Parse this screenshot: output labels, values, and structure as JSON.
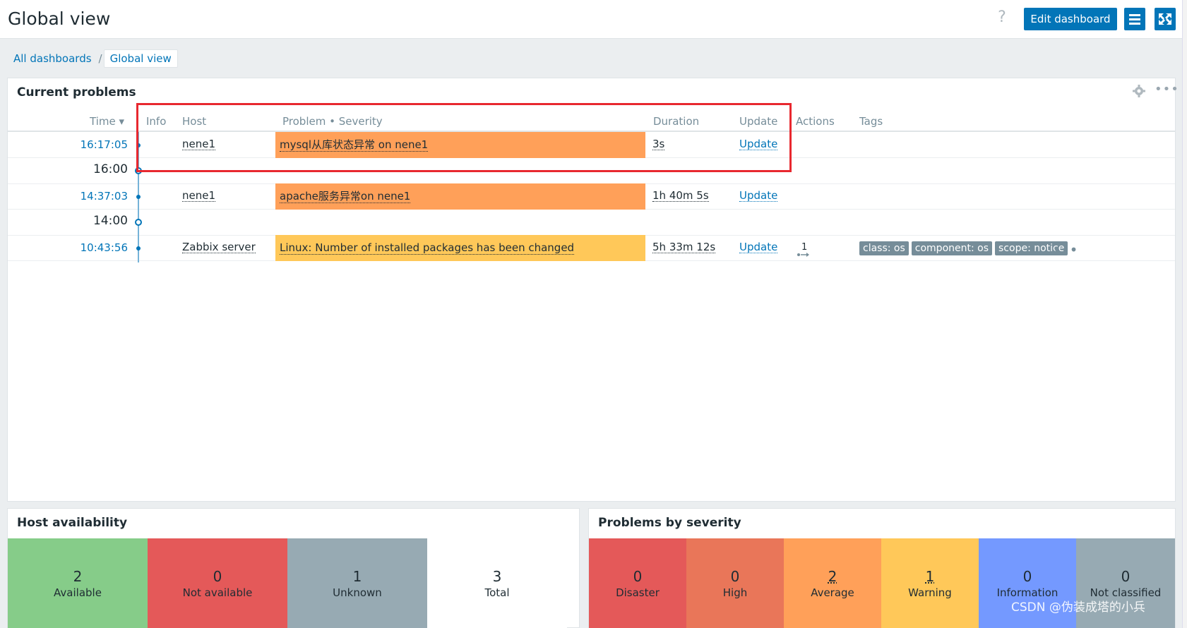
{
  "header": {
    "title": "Global view",
    "help": "?",
    "edit_button": "Edit dashboard"
  },
  "breadcrumb": {
    "all": "All dashboards",
    "sep": "/",
    "current": "Global view"
  },
  "problems_widget": {
    "title": "Current problems",
    "more": "•••",
    "columns": {
      "time": "Time ▾",
      "info": "Info",
      "host": "Host",
      "problem": "Problem • Severity",
      "duration": "Duration",
      "update": "Update",
      "actions": "Actions",
      "tags": "Tags"
    },
    "rows": [
      {
        "time": "16:17:05",
        "host": "nene1",
        "problem": "mysql从库状态异常 on nene1",
        "severity_color": "#ffa059",
        "duration": "3s",
        "update": "Update"
      },
      {
        "time_mark": "16:00"
      },
      {
        "time": "14:37:03",
        "host": "nene1",
        "problem": "apache服务异常on nene1",
        "severity_color": "#ffa059",
        "duration": "1h 40m 5s",
        "update": "Update"
      },
      {
        "time_mark": "14:00"
      },
      {
        "time": "10:43:56",
        "host": "Zabbix server",
        "problem": "Linux: Number of installed packages has been changed",
        "severity_color": "#ffc859",
        "duration": "5h 33m 12s",
        "update": "Update",
        "actions_count": "1",
        "tags": [
          "class: os",
          "component: os",
          "scope: notice"
        ],
        "tags_more": "•••"
      }
    ]
  },
  "host_availability": {
    "title": "Host availability",
    "tiles": [
      {
        "count": "2",
        "label": "Available",
        "color": "#86cc89"
      },
      {
        "count": "0",
        "label": "Not available",
        "color": "#e45959"
      },
      {
        "count": "1",
        "label": "Unknown",
        "color": "#97aab3"
      },
      {
        "count": "3",
        "label": "Total",
        "color": "#ffffff"
      }
    ]
  },
  "problems_by_severity": {
    "title": "Problems by severity",
    "tiles": [
      {
        "count": "0",
        "label": "Disaster",
        "color": "#e45959"
      },
      {
        "count": "0",
        "label": "High",
        "color": "#e97659"
      },
      {
        "count": "2",
        "label": "Average",
        "color": "#ffa059"
      },
      {
        "count": "1",
        "label": "Warning",
        "color": "#ffc859"
      },
      {
        "count": "0",
        "label": "Information",
        "color": "#7499ff"
      },
      {
        "count": "0",
        "label": "Not classified",
        "color": "#97aab3"
      }
    ]
  },
  "watermark": "CSDN @伪装成塔的小兵"
}
